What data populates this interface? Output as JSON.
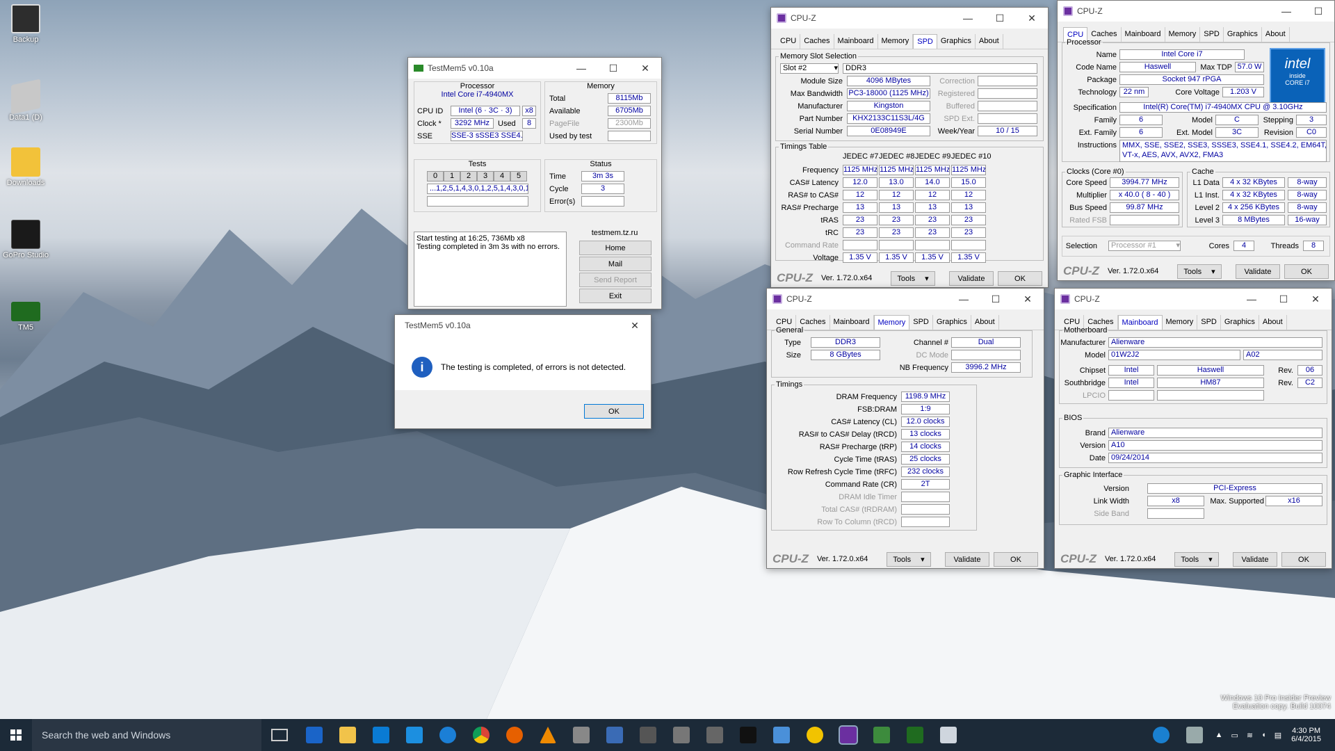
{
  "desktop": {
    "icons": [
      {
        "label": "Backup"
      },
      {
        "label": "Data1 (D)"
      },
      {
        "label": "Downloads"
      },
      {
        "label": "GoPro Studio"
      },
      {
        "label": "TM5"
      }
    ],
    "watermark1": "Windows 10 Pro Insider Preview",
    "watermark2": "Evaluation copy. Build 10074"
  },
  "taskbar": {
    "search_placeholder": "Search the web and Windows",
    "time": "4:30 PM",
    "date": "6/4/2015"
  },
  "tm": {
    "title": "TestMem5 v0.10a",
    "processor_hdr": "Processor",
    "cpu_name": "Intel Core i7-4940MX",
    "cpuid_label": "CPU ID",
    "cpuid_val": "Intel (6 · 3C · 3)",
    "cpuid_x": "x8",
    "clock_label": "Clock *",
    "clock_val": "3292 MHz",
    "used_label": "Used",
    "used_val": "8",
    "sse_label": "SSE",
    "sse_val": "SSE-3 sSSE3 SSE4.1",
    "memory_hdr": "Memory",
    "total_label": "Total",
    "total_val": "8115Mb",
    "avail_label": "Available",
    "avail_val": "6705Mb",
    "pagefile_label": "PageFile",
    "pagefile_val": "2300Mb",
    "usedby_label": "Used by test",
    "tests_hdr": "Tests",
    "tests": [
      "0",
      "1",
      "2",
      "3",
      "4",
      "5"
    ],
    "tests_seq": "...1,2,5,1,4,3,0,1,2,5,1,4,3,0,1",
    "status_hdr": "Status",
    "time_label": "Time",
    "time_val": "3m 3s",
    "cycle_label": "Cycle",
    "cycle_val": "3",
    "errors_label": "Error(s)",
    "log1": "Start testing at 16:25, 736Mb x8",
    "log2": "Testing completed in 3m 3s with no errors.",
    "site": "testmem.tz.ru",
    "home": "Home",
    "mail": "Mail",
    "send": "Send Report",
    "exit": "Exit"
  },
  "dlg": {
    "title": "TestMem5 v0.10a",
    "msg": "The testing is completed, of errors is not detected.",
    "ok": "OK"
  },
  "cpuz_common": {
    "title": "CPU-Z",
    "logo": "CPU-Z",
    "version": "Ver. 1.72.0.x64",
    "tools": "Tools",
    "validate": "Validate",
    "ok": "OK",
    "tabs": [
      "CPU",
      "Caches",
      "Mainboard",
      "Memory",
      "SPD",
      "Graphics",
      "About"
    ]
  },
  "spd": {
    "slot_legend": "Memory Slot Selection",
    "slot": "Slot #2",
    "type": "DDR3",
    "module_size_l": "Module Size",
    "module_size": "4096 MBytes",
    "max_bw_l": "Max Bandwidth",
    "max_bw": "PC3-18000 (1125 MHz)",
    "manuf_l": "Manufacturer",
    "manuf": "Kingston",
    "part_l": "Part Number",
    "part": "KHX2133C11S3L/4G",
    "serial_l": "Serial Number",
    "serial": "0E08949E",
    "correction": "Correction",
    "registered": "Registered",
    "buffered": "Buffered",
    "spdext": "SPD Ext.",
    "weekyear_l": "Week/Year",
    "weekyear": "10 / 15",
    "timings_legend": "Timings Table",
    "cols": [
      "JEDEC #7",
      "JEDEC #8",
      "JEDEC #9",
      "JEDEC #10"
    ],
    "rows": [
      {
        "l": "Frequency",
        "v": [
          "1125 MHz",
          "1125 MHz",
          "1125 MHz",
          "1125 MHz"
        ]
      },
      {
        "l": "CAS# Latency",
        "v": [
          "12.0",
          "13.0",
          "14.0",
          "15.0"
        ]
      },
      {
        "l": "RAS# to CAS#",
        "v": [
          "12",
          "12",
          "12",
          "12"
        ]
      },
      {
        "l": "RAS# Precharge",
        "v": [
          "13",
          "13",
          "13",
          "13"
        ]
      },
      {
        "l": "tRAS",
        "v": [
          "23",
          "23",
          "23",
          "23"
        ]
      },
      {
        "l": "tRC",
        "v": [
          "23",
          "23",
          "23",
          "23"
        ]
      },
      {
        "l": "Command Rate",
        "v": [
          "",
          "",
          "",
          ""
        ]
      },
      {
        "l": "Voltage",
        "v": [
          "1.35 V",
          "1.35 V",
          "1.35 V",
          "1.35 V"
        ]
      }
    ]
  },
  "cpu": {
    "proc_legend": "Processor",
    "name_l": "Name",
    "name": "Intel Core i7",
    "code_l": "Code Name",
    "code": "Haswell",
    "tdp_l": "Max TDP",
    "tdp": "57.0 W",
    "pkg_l": "Package",
    "pkg": "Socket 947 rPGA",
    "tech_l": "Technology",
    "tech": "22 nm",
    "cv_l": "Core Voltage",
    "cv": "1.203 V",
    "spec_l": "Specification",
    "spec": "Intel(R) Core(TM) i7-4940MX CPU @ 3.10GHz",
    "fam_l": "Family",
    "fam": "6",
    "model_l": "Model",
    "model": "C",
    "step_l": "Stepping",
    "step": "3",
    "efam_l": "Ext. Family",
    "efam": "6",
    "emodel_l": "Ext. Model",
    "emodel": "3C",
    "rev_l": "Revision",
    "rev": "C0",
    "instr_l": "Instructions",
    "instr1": "MMX, SSE, SSE2, SSE3, SSSE3, SSE4.1, SSE4.2, EM64T,",
    "instr2": "VT-x, AES, AVX, AVX2, FMA3",
    "intel1": "intel",
    "intel2": "inside",
    "intel3": "CORE i7",
    "clocks_legend": "Clocks (Core #0)",
    "cs_l": "Core Speed",
    "cs": "3994.77 MHz",
    "mult_l": "Multiplier",
    "mult": "x 40.0 ( 8 - 40 )",
    "bus_l": "Bus Speed",
    "bus": "99.87 MHz",
    "fsb_l": "Rated FSB",
    "cache_legend": "Cache",
    "l1d_l": "L1 Data",
    "l1d": "4 x 32 KBytes",
    "l1d_w": "8-way",
    "l1i_l": "L1 Inst.",
    "l1i": "4 x 32 KBytes",
    "l1i_w": "8-way",
    "l2_l": "Level 2",
    "l2": "4 x 256 KBytes",
    "l2_w": "8-way",
    "l3_l": "Level 3",
    "l3": "8 MBytes",
    "l3_w": "16-way",
    "sel_l": "Selection",
    "sel": "Processor #1",
    "cores_l": "Cores",
    "cores": "4",
    "threads_l": "Threads",
    "threads": "8"
  },
  "mem": {
    "gen_legend": "General",
    "type_l": "Type",
    "type": "DDR3",
    "size_l": "Size",
    "size": "8 GBytes",
    "ch_l": "Channel #",
    "ch": "Dual",
    "dc_l": "DC Mode",
    "nb_l": "NB Frequency",
    "nb": "3996.2 MHz",
    "tim_legend": "Timings",
    "rows": [
      {
        "l": "DRAM Frequency",
        "v": "1198.9 MHz"
      },
      {
        "l": "FSB:DRAM",
        "v": "1:9"
      },
      {
        "l": "CAS# Latency (CL)",
        "v": "12.0 clocks"
      },
      {
        "l": "RAS# to CAS# Delay (tRCD)",
        "v": "13 clocks"
      },
      {
        "l": "RAS# Precharge (tRP)",
        "v": "14 clocks"
      },
      {
        "l": "Cycle Time (tRAS)",
        "v": "25 clocks"
      },
      {
        "l": "Row Refresh Cycle Time (tRFC)",
        "v": "232 clocks"
      },
      {
        "l": "Command Rate (CR)",
        "v": "2T"
      }
    ],
    "grey": [
      "DRAM Idle Timer",
      "Total CAS# (tRDRAM)",
      "Row To Column (tRCD)"
    ]
  },
  "mb": {
    "mb_legend": "Motherboard",
    "man_l": "Manufacturer",
    "man": "Alienware",
    "model_l": "Model",
    "model": "01W2J2",
    "model2": "A02",
    "chip_l": "Chipset",
    "chip1": "Intel",
    "chip2": "Haswell",
    "rev_l": "Rev.",
    "chiprev": "06",
    "sb_l": "Southbridge",
    "sb1": "Intel",
    "sb2": "HM87",
    "sbrev": "C2",
    "lpcio_l": "LPCIO",
    "bios_legend": "BIOS",
    "brand_l": "Brand",
    "brand": "Alienware",
    "ver_l": "Version",
    "ver": "A10",
    "date_l": "Date",
    "date": "09/24/2014",
    "gi_legend": "Graphic Interface",
    "giver_l": "Version",
    "giver": "PCI-Express",
    "lw_l": "Link Width",
    "lw": "x8",
    "ms_l": "Max. Supported",
    "ms": "x16",
    "sb2_l": "Side Band"
  }
}
